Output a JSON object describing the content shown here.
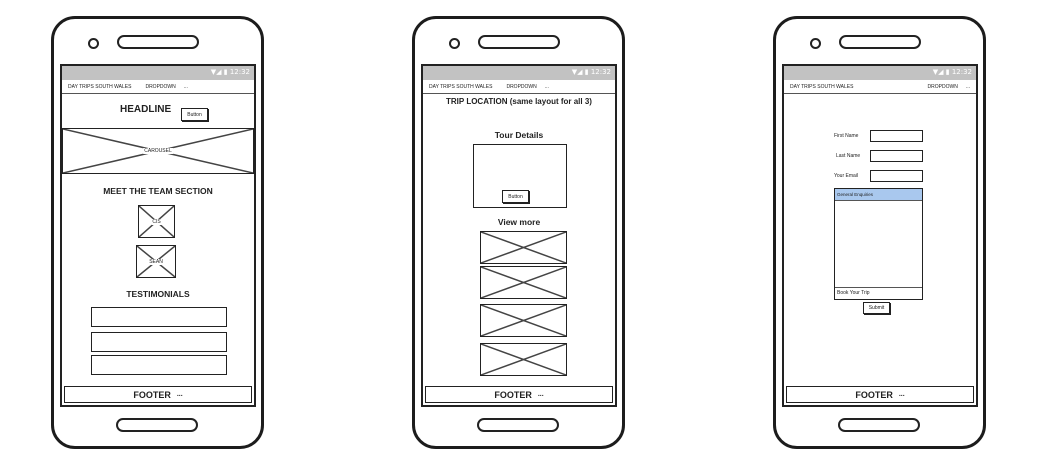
{
  "status_bar": {
    "time": "12:32"
  },
  "screen1": {
    "nav": {
      "brand": "DAY TRIPS SOUTH WALES",
      "dropdown": "DROPDOWN",
      "more": "..."
    },
    "headline": "HEADLINE",
    "headline_button": "Button",
    "carousel_label": "CAROUSEL",
    "team_heading": "MEET THE TEAM SECTION",
    "team_members": [
      "CIS",
      "SEAN"
    ],
    "testimonials_heading": "TESTIMONIALS",
    "footer": {
      "label": "FOOTER",
      "more": "..."
    }
  },
  "screen2": {
    "nav": {
      "brand": "DAY TRIPS SOUTH WALES",
      "dropdown": "DROPDOWN",
      "more": "..."
    },
    "title": "TRIP LOCATION (same layout for all 3)",
    "tour_heading": "Tour Details",
    "tour_button": "Button",
    "view_more_heading": "View more",
    "footer": {
      "label": "FOOTER",
      "more": "..."
    }
  },
  "screen3": {
    "nav": {
      "brand": "DAY TRIPS SOUTH WALES",
      "dropdown": "DROPDOWN",
      "more": "..."
    },
    "form": {
      "first_name_label": "First Name",
      "last_name_label": "Last Name",
      "email_label": "Your Email",
      "selected_option": "General Enquiries",
      "footer_option": "Book Your Trip",
      "submit_label": "Submit"
    },
    "footer": {
      "label": "FOOTER",
      "more": "..."
    }
  }
}
